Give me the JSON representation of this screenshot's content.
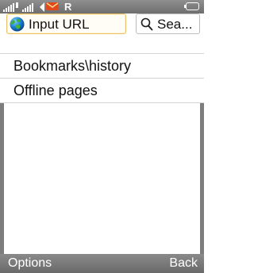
{
  "status_bar": {
    "roaming_indicator": "R",
    "icons": [
      "signal-strength-icon",
      "signal-strength-icon",
      "network-indicator-icon",
      "message-icon",
      "battery-icon"
    ]
  },
  "toolbar": {
    "url_label": "Input URL",
    "search_label": "Sea..."
  },
  "menu": {
    "items": [
      {
        "label": "Bookmarks\\history"
      },
      {
        "label": "Offline pages"
      }
    ]
  },
  "softkeys": {
    "left": "Options",
    "right": "Back"
  },
  "colors": {
    "status_bar": "#7e7e7e",
    "url_border": "#e8c16a",
    "divider": "#d4d4d4"
  }
}
